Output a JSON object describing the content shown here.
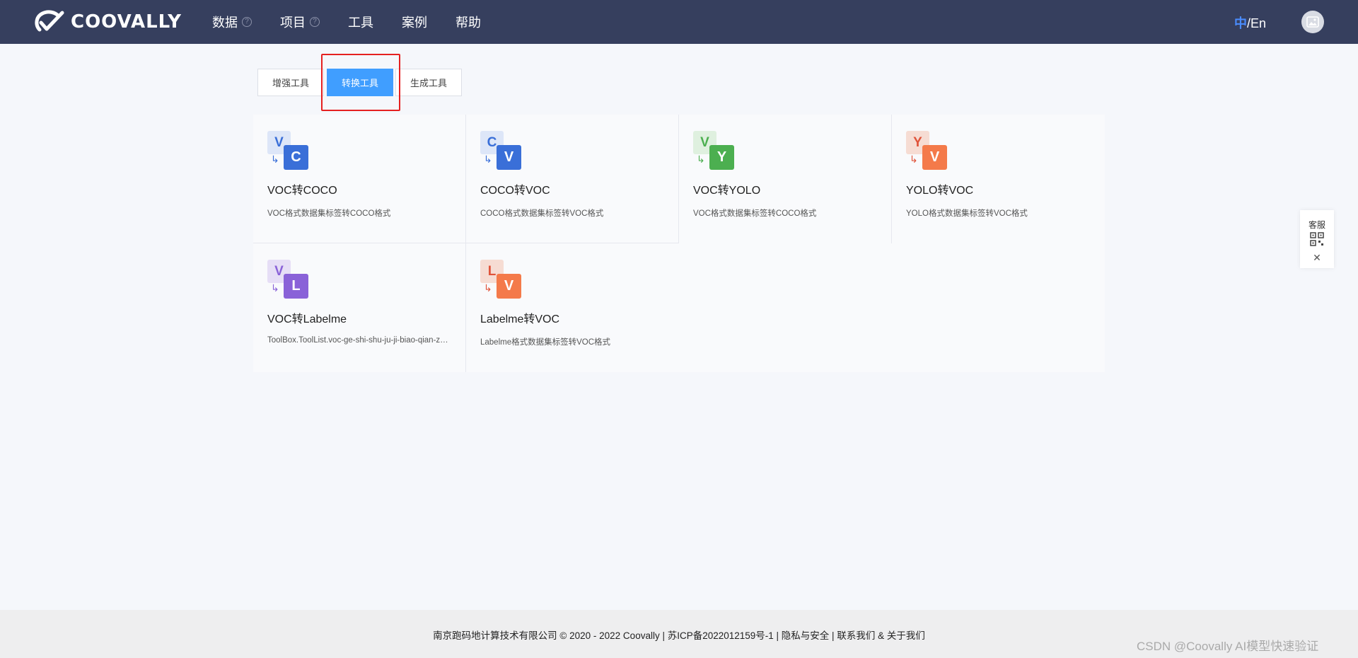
{
  "header": {
    "brand": "COOVALLY",
    "nav": [
      {
        "label": "数据",
        "help": true
      },
      {
        "label": "项目",
        "help": true
      },
      {
        "label": "工具",
        "help": false
      },
      {
        "label": "案例",
        "help": false
      },
      {
        "label": "帮助",
        "help": false
      }
    ],
    "lang_zh": "中",
    "lang_sep": "/",
    "lang_en": "En"
  },
  "tabs": [
    {
      "label": "增强工具",
      "active": false
    },
    {
      "label": "转换工具",
      "active": true
    },
    {
      "label": "生成工具",
      "active": false
    }
  ],
  "tools": [
    {
      "title": "VOC转COCO",
      "desc": "VOC格式数据集标签转COCO格式",
      "from": "V",
      "to": "C",
      "back_bg": "#dde6f8",
      "back_fg": "#3a6fd8",
      "front_bg": "#3a6fd8",
      "arrow": "#3a6fd8"
    },
    {
      "title": "COCO转VOC",
      "desc": "COCO格式数据集标签转VOC格式",
      "from": "C",
      "to": "V",
      "back_bg": "#dde6f8",
      "back_fg": "#3a6fd8",
      "front_bg": "#3a6fd8",
      "arrow": "#3a6fd8"
    },
    {
      "title": "VOC转YOLO",
      "desc": "VOC格式数据集标签转COCO格式",
      "from": "V",
      "to": "Y",
      "back_bg": "#dff0df",
      "back_fg": "#4caf50",
      "front_bg": "#4caf50",
      "arrow": "#4caf50"
    },
    {
      "title": "YOLO转VOC",
      "desc": "YOLO格式数据集标签转VOC格式",
      "from": "Y",
      "to": "V",
      "back_bg": "#f6dcd3",
      "back_fg": "#e0533a",
      "front_bg": "#f47a4a",
      "arrow": "#e0533a"
    },
    {
      "title": "VOC转Labelme",
      "desc": "ToolBox.ToolList.voc-ge-shi-shu-ju-ji-biao-qian-zhuan-labelme-ge-shi",
      "from": "V",
      "to": "L",
      "back_bg": "#e6def6",
      "back_fg": "#8a62d8",
      "front_bg": "#8a62d8",
      "arrow": "#8a62d8"
    },
    {
      "title": "Labelme转VOC",
      "desc": "Labelme格式数据集标签转VOC格式",
      "from": "L",
      "to": "V",
      "back_bg": "#f6dcd3",
      "back_fg": "#e0533a",
      "front_bg": "#f47a4a",
      "arrow": "#e0533a"
    }
  ],
  "service": {
    "label": "客服"
  },
  "footer": {
    "text": "南京跑码地计算技术有限公司 © 2020 - 2022 Coovally | 苏ICP备2022012159号-1 | 隐私与安全 | 联系我们 & 关于我们"
  },
  "watermark": "CSDN @Coovally   AI模型快速验证",
  "colors": {
    "header_bg": "#363f5e",
    "accent": "#409eff",
    "highlight": "#e52020"
  }
}
